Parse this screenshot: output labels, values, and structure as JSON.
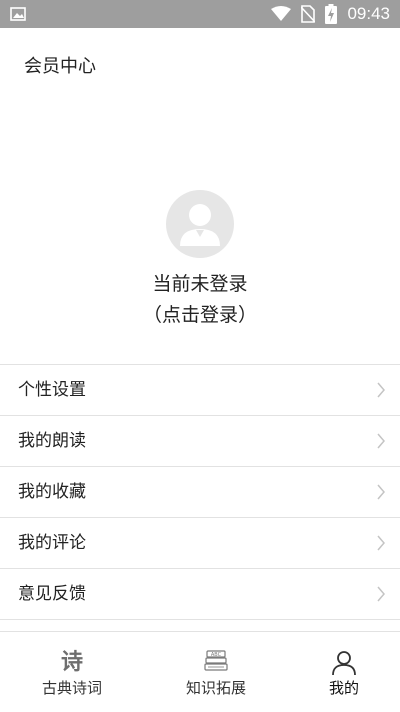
{
  "status_bar": {
    "time": "09:43",
    "icons": [
      "image-icon",
      "wifi-icon",
      "no-sim-icon",
      "battery-charging-icon"
    ]
  },
  "header": {
    "title": "会员中心"
  },
  "profile": {
    "avatar_icon": "user-avatar-icon",
    "status_text": "当前未登录",
    "login_text": "（点击登录）"
  },
  "menu": {
    "items": [
      {
        "label": "个性设置"
      },
      {
        "label": "我的朗读"
      },
      {
        "label": "我的收藏"
      },
      {
        "label": "我的评论"
      },
      {
        "label": "意见反馈"
      }
    ],
    "chevron_icon": "chevron-right-icon"
  },
  "bottom_nav": {
    "items": [
      {
        "label": "古典诗词",
        "icon": "poem-icon",
        "glyph": "诗",
        "active": false
      },
      {
        "label": "知识拓展",
        "icon": "books-icon",
        "active": false
      },
      {
        "label": "我的",
        "icon": "person-icon",
        "active": true
      }
    ]
  },
  "colors": {
    "status_bar_bg": "#9e9e9e",
    "divider": "#e2e2e2",
    "avatar_bg": "#e6e6e6",
    "text": "#222222"
  }
}
